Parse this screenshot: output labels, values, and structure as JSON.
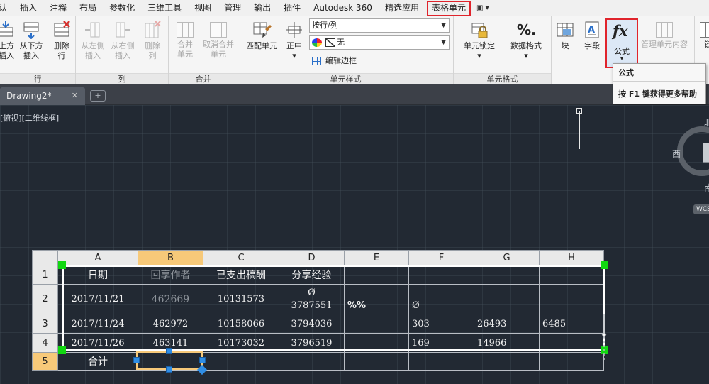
{
  "menu": {
    "items": [
      "认",
      "插入",
      "注释",
      "布局",
      "参数化",
      "三维工具",
      "视图",
      "管理",
      "输出",
      "插件",
      "Autodesk 360",
      "精选应用",
      "表格单元"
    ],
    "active_index": 12,
    "dropdown_icon": "▣ ▾"
  },
  "ribbon": {
    "panels": {
      "rows": "行",
      "cols": "列",
      "merge": "合并",
      "cell_style": "单元样式",
      "cell_format": "单元格式"
    },
    "tools": {
      "row_above": [
        "上方",
        "插入"
      ],
      "row_below": [
        "从下方",
        "插入"
      ],
      "delete_row": [
        "删除",
        "行"
      ],
      "col_left": [
        "从左侧",
        "插入"
      ],
      "col_right": [
        "从右侧",
        "插入"
      ],
      "delete_col": [
        "删除",
        "列"
      ],
      "merge_cells": [
        "合并",
        "单元"
      ],
      "unmerge_cells": [
        "取消合并",
        "单元"
      ],
      "match_cell": "匹配单元",
      "align_center": "正中",
      "row_col_select": "按行/列",
      "fill_select": "无",
      "edit_borders": "编辑边框",
      "cell_lock": "单元锁定",
      "data_format": "数据格式",
      "block": "块",
      "field": "字段",
      "formula": "公式",
      "manage_content": "管理单元内容",
      "link": "链"
    }
  },
  "tooltip": {
    "title": "公式",
    "help": "按 F1 键获得更多帮助"
  },
  "tabs": {
    "document": "Drawing2*",
    "close": "✕",
    "new": "+"
  },
  "viewport": {
    "label": "[俯视][二维线框]",
    "compass": {
      "west": "西",
      "north": "北",
      "south": "南",
      "wcs": "WCS"
    }
  },
  "table": {
    "columns": [
      "A",
      "B",
      "C",
      "D",
      "E",
      "F",
      "G",
      "H"
    ],
    "selected_column": "B",
    "selected_row": "5",
    "rows": [
      {
        "num": "1",
        "cells": [
          "日期",
          "回享作者",
          "已支出稿酬",
          "分享经验",
          "",
          "",
          "",
          ""
        ]
      },
      {
        "num": "2",
        "cells": [
          "2017/11/21",
          "462669",
          "10131573",
          "Ø\n3787551",
          "%%",
          "Ø",
          "",
          ""
        ]
      },
      {
        "num": "3",
        "cells": [
          "2017/11/24",
          "462972",
          "10158066",
          "3794036",
          "",
          "303",
          "26493",
          "6485"
        ]
      },
      {
        "num": "4",
        "cells": [
          "2017/11/26",
          "463141",
          "10173032",
          "3796519",
          "",
          "169",
          "14966",
          ""
        ]
      },
      {
        "num": "5",
        "cells": [
          "合计",
          "",
          "",
          "",
          "",
          "",
          "",
          ""
        ]
      }
    ]
  },
  "colors": {
    "highlight_red": "#e0242c",
    "selection_orange": "#f7c979",
    "grip_green": "#11d811",
    "grip_blue": "#2f8de4",
    "canvas_bg": "#222933"
  }
}
